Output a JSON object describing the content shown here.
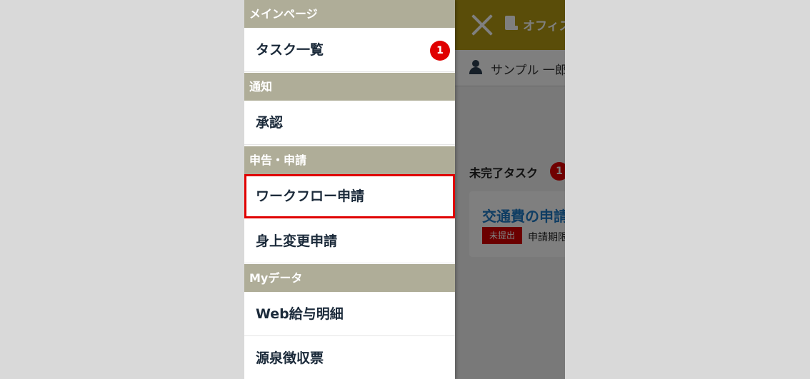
{
  "drawer": {
    "sections": [
      {
        "title": "メインページ",
        "items": [
          {
            "label": "タスク一覧",
            "badge": "1"
          }
        ]
      },
      {
        "title": "通知",
        "items": [
          {
            "label": "承認"
          }
        ]
      },
      {
        "title": "申告・申請",
        "items": [
          {
            "label": "ワークフロー申請",
            "selected": true
          },
          {
            "label": "身上変更申請"
          }
        ]
      },
      {
        "title": "Myデータ",
        "items": [
          {
            "label": "Web給与明細"
          },
          {
            "label": "源泉徴収票"
          }
        ]
      }
    ]
  },
  "app": {
    "header_title": "オフィス",
    "user_name": "サンプル 一郎様",
    "tasks_heading": "未完了タスク",
    "tasks_count": "1",
    "task_card": {
      "title": "交通費の申請",
      "status": "未提出",
      "deadline": "申請期限"
    }
  },
  "colors": {
    "section_header_bg": "#afad98",
    "header_bg": "#b59a12",
    "badge": "#e00000",
    "link": "#1f7bc7",
    "selected_outline": "#e00000"
  },
  "icons": [
    "close-icon",
    "office-icon",
    "user-icon"
  ]
}
